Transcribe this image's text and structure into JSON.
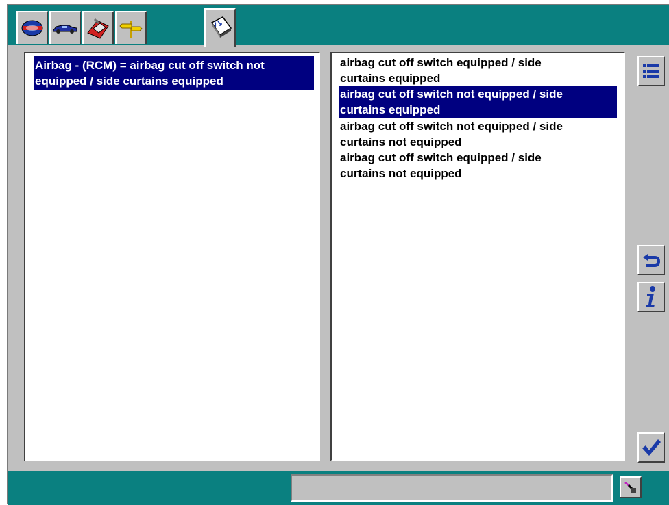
{
  "left_panel": {
    "prefix": "Airbag - (",
    "abbr": "RCM",
    "suffix": ") = airbag cut off switch not equipped / side curtains equipped"
  },
  "right_panel": {
    "options": [
      {
        "line1": "airbag cut off switch equipped / side",
        "line2": "curtains equipped",
        "selected": false
      },
      {
        "line1": "airbag cut off switch not equipped / side",
        "line2": "curtains equipped",
        "selected": true
      },
      {
        "line1": "airbag cut off switch not equipped / side",
        "line2": "curtains not equipped",
        "selected": false
      },
      {
        "line1": "airbag cut off switch equipped / side",
        "line2": "curtains not equipped",
        "selected": false
      }
    ]
  },
  "tabs": [
    {
      "icon": "vehicle-badge-icon"
    },
    {
      "icon": "car-icon"
    },
    {
      "icon": "toolbox-icon"
    },
    {
      "icon": "signpost-icon"
    },
    {
      "icon": "book-info-icon",
      "active": true
    }
  ],
  "sidebar": {
    "icons": [
      "list-icon",
      "return-arrow-icon",
      "info-icon",
      "checkmark-icon"
    ]
  },
  "colors": {
    "teal": "#0a8080",
    "selection": "#000080",
    "face": "#c0c0c0"
  }
}
